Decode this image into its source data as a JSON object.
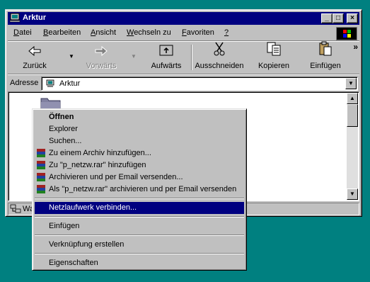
{
  "window": {
    "title": "Arktur",
    "minimize": "_",
    "maximize": "□",
    "close": "×"
  },
  "menu": [
    "Datei",
    "Bearbeiten",
    "Ansicht",
    "Wechseln zu",
    "Favoriten",
    "?"
  ],
  "menu_access": [
    "D",
    "B",
    "A",
    "W",
    "F",
    "?"
  ],
  "toolbar": {
    "back": "Zurück",
    "forward": "Vorwärts",
    "up": "Aufwärts",
    "cut": "Ausschneiden",
    "copy": "Kopieren",
    "paste": "Einfügen",
    "more": "»",
    "dropdown": "▼"
  },
  "address": {
    "label": "Adresse",
    "value": "Arktur",
    "dropdown": "▼"
  },
  "scroll": {
    "up": "▲",
    "down": "▼"
  },
  "status": {
    "text": "Wa"
  },
  "context_menu": {
    "open": "Öffnen",
    "explorer": "Explorer",
    "search": "Suchen...",
    "add_archive": "Zu einem Archiv hinzufügen...",
    "add_rar": "Zu \"p_netzw.rar\" hinzufügen",
    "archive_email": "Archivieren und per Email versenden...",
    "rar_email": "Als \"p_netzw.rar\" archivieren und per Email versenden",
    "map_drive": "Netzlaufwerk verbinden...",
    "paste": "Einfügen",
    "shortcut": "Verknüpfung erstellen",
    "properties": "Eigenschaften"
  },
  "colors": {
    "desktop": "#008080",
    "titlebar": "#000080",
    "highlight": "#000080",
    "face": "#c0c0c0"
  }
}
